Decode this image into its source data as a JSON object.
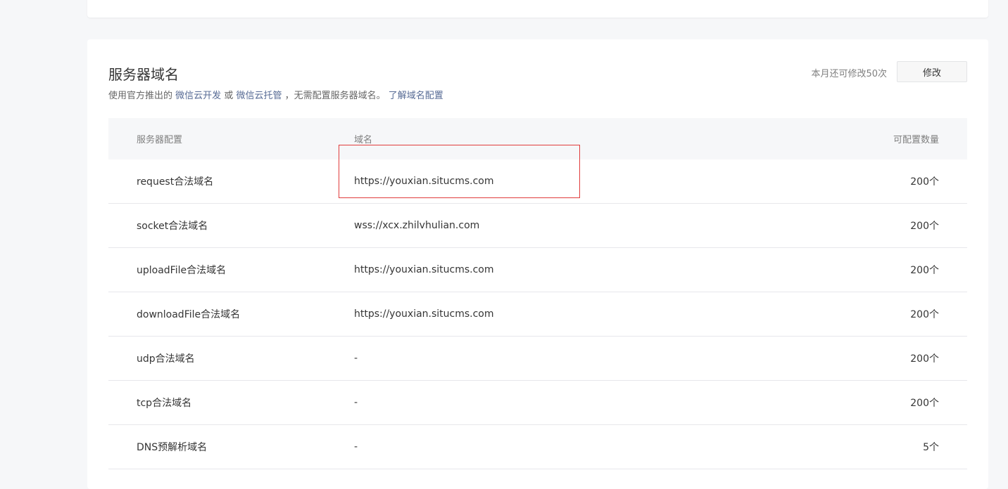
{
  "section": {
    "title": "服务器域名",
    "desc_prefix": "使用官方推出的",
    "link_cloud_dev": "微信云开发",
    "desc_or": "或",
    "link_cloud_host": "微信云托管",
    "desc_suffix": "，无需配置服务器域名。",
    "link_learn": "了解域名配置",
    "quota_text": "本月还可修改50次",
    "modify_label": "修改"
  },
  "table": {
    "headers": [
      "服务器配置",
      "域名",
      "可配置数量"
    ],
    "rows": [
      {
        "type": "request合法域名",
        "domain": "https://youxian.situcms.com",
        "count": "200个"
      },
      {
        "type": "socket合法域名",
        "domain": "wss://xcx.zhilvhulian.com",
        "count": "200个"
      },
      {
        "type": "uploadFile合法域名",
        "domain": "https://youxian.situcms.com",
        "count": "200个"
      },
      {
        "type": "downloadFile合法域名",
        "domain": "https://youxian.situcms.com",
        "count": "200个"
      },
      {
        "type": "udp合法域名",
        "domain": "-",
        "count": "200个"
      },
      {
        "type": "tcp合法域名",
        "domain": "-",
        "count": "200个"
      },
      {
        "type": "DNS预解析域名",
        "domain": "-",
        "count": "5个"
      }
    ]
  },
  "colors": {
    "link": "#576b95",
    "highlight": "#e03c3c"
  }
}
